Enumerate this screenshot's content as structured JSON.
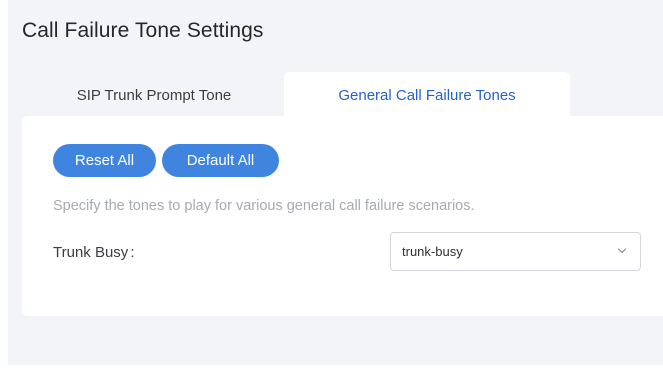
{
  "page": {
    "title": "Call Failure Tone Settings"
  },
  "tabs": [
    {
      "label": "SIP Trunk Prompt Tone",
      "active": false
    },
    {
      "label": "General Call Failure Tones",
      "active": true
    }
  ],
  "actions": {
    "reset_all_label": "Reset All",
    "default_all_label": "Default All"
  },
  "description": "Specify the tones to play for various general call failure scenarios.",
  "fields": {
    "trunk_busy": {
      "label": "Trunk Busy",
      "separator": ":",
      "value": "trunk-busy"
    }
  },
  "icons": {
    "select_arrow": "chevron-down-icon"
  },
  "colors": {
    "accent": "#3f85df",
    "active_tab_text": "#2563c4",
    "background": "#f3f4f7",
    "panel": "#ffffff",
    "hint_text": "#a6aab2"
  }
}
